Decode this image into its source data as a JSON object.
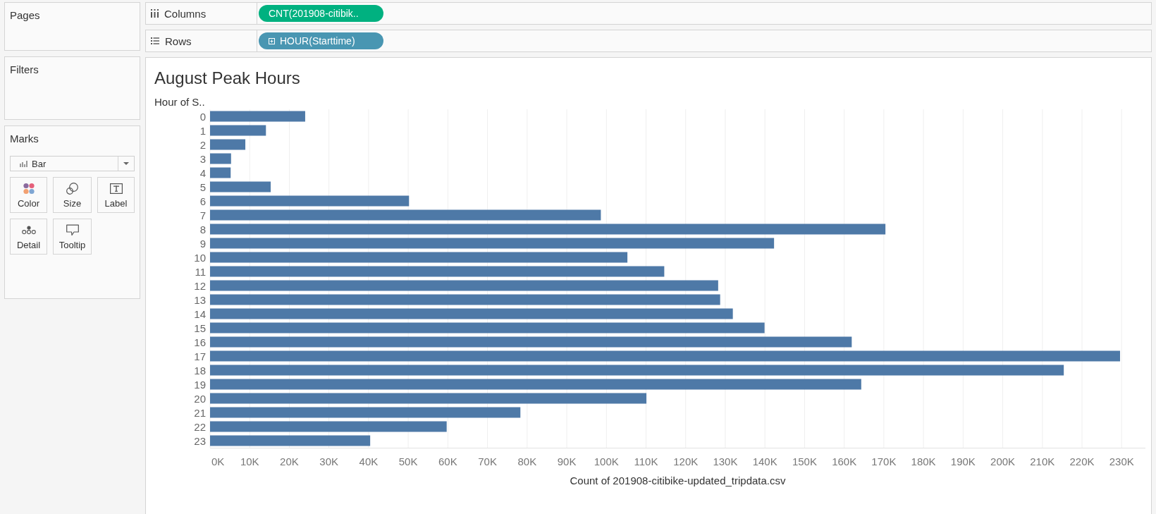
{
  "sidebar": {
    "pages": {
      "title": "Pages"
    },
    "filters": {
      "title": "Filters"
    },
    "marks": {
      "title": "Marks",
      "mark_type": "Bar",
      "cards": [
        {
          "label": "Color",
          "kind": "color"
        },
        {
          "label": "Size",
          "kind": "size"
        },
        {
          "label": "Label",
          "kind": "label"
        },
        {
          "label": "Detail",
          "kind": "detail"
        },
        {
          "label": "Tooltip",
          "kind": "tooltip"
        }
      ]
    }
  },
  "shelves": [
    {
      "kind": "columns",
      "label": "Columns",
      "pill": {
        "text": "CNT(201908-citibik..",
        "kind": "continuous",
        "expandable": false
      }
    },
    {
      "kind": "rows",
      "label": "Rows",
      "pill": {
        "text": "HOUR(Starttime)",
        "kind": "discrete",
        "expandable": true
      }
    }
  ],
  "view": {
    "title": "August Peak Hours",
    "chart_data": {
      "type": "bar",
      "orientation": "horizontal",
      "grid": true,
      "ylabel": "Hour of S..",
      "xlabel": "Count of 201908-citibike-updated_tripdata.csv",
      "categories": [
        "0",
        "1",
        "2",
        "3",
        "4",
        "5",
        "6",
        "7",
        "8",
        "9",
        "10",
        "11",
        "12",
        "13",
        "14",
        "15",
        "16",
        "17",
        "18",
        "19",
        "20",
        "21",
        "22",
        "23"
      ],
      "values": [
        24000,
        14100,
        8900,
        5300,
        5200,
        15300,
        50200,
        98600,
        170400,
        142300,
        105300,
        114600,
        128200,
        128700,
        131900,
        139900,
        161900,
        229600,
        215400,
        164300,
        110100,
        78300,
        59700,
        40400
      ],
      "xlim": [
        0,
        236000
      ],
      "xticks": [
        {
          "value": 0,
          "label": "0K"
        },
        {
          "value": 10000,
          "label": "10K"
        },
        {
          "value": 20000,
          "label": "20K"
        },
        {
          "value": 30000,
          "label": "30K"
        },
        {
          "value": 40000,
          "label": "40K"
        },
        {
          "value": 50000,
          "label": "50K"
        },
        {
          "value": 60000,
          "label": "60K"
        },
        {
          "value": 70000,
          "label": "70K"
        },
        {
          "value": 80000,
          "label": "80K"
        },
        {
          "value": 90000,
          "label": "90K"
        },
        {
          "value": 100000,
          "label": "100K"
        },
        {
          "value": 110000,
          "label": "110K"
        },
        {
          "value": 120000,
          "label": "120K"
        },
        {
          "value": 130000,
          "label": "130K"
        },
        {
          "value": 140000,
          "label": "140K"
        },
        {
          "value": 150000,
          "label": "150K"
        },
        {
          "value": 160000,
          "label": "160K"
        },
        {
          "value": 170000,
          "label": "170K"
        },
        {
          "value": 180000,
          "label": "180K"
        },
        {
          "value": 190000,
          "label": "190K"
        },
        {
          "value": 200000,
          "label": "200K"
        },
        {
          "value": 210000,
          "label": "210K"
        },
        {
          "value": 220000,
          "label": "220K"
        },
        {
          "value": 230000,
          "label": "230K"
        }
      ]
    }
  }
}
